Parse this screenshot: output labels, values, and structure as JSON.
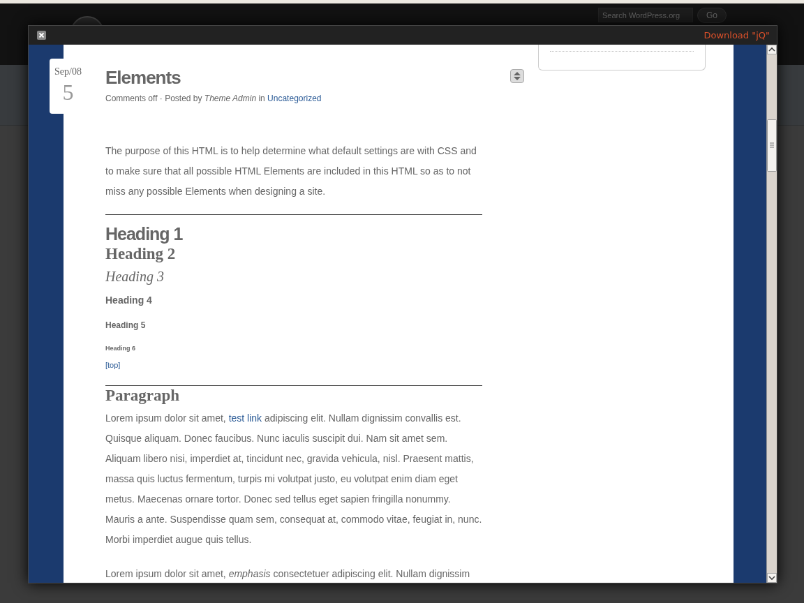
{
  "background_page": {
    "search": {
      "placeholder": "Search WordPress.org"
    },
    "go_button": "Go"
  },
  "modal": {
    "download_link": "Download \"jQ\""
  },
  "post": {
    "date": {
      "month": "Sep/08",
      "day": "5"
    },
    "title": "Elements",
    "meta": "Comments off · Posted by *Theme Admin* in",
    "category": "Uncategorized",
    "intro": "The purpose of this HTML is to help determine what default settings are with CSS and to make sure that all possible HTML Elements are included in this HTML so as to not miss any possible Elements when designing a site.",
    "headings": [
      {
        "kind": "h1",
        "text": "Heading 1"
      },
      {
        "kind": "h2",
        "text": "Heading 2"
      },
      {
        "kind": "h3",
        "text": "Heading 3"
      },
      {
        "kind": "h4",
        "text": "Heading 4"
      },
      {
        "kind": "h5",
        "text": "Heading 5"
      },
      {
        "kind": "h6",
        "text": "Heading 6"
      }
    ],
    "top_link": "[top]",
    "section_title": "Paragraph",
    "paragraphs": [
      [
        {
          "kind": "text",
          "text": "Lorem ipsum dolor sit amet,"
        },
        {
          "kind": "link",
          "text": "test link"
        },
        {
          "kind": "text",
          "text": "adipiscing elit. Nullam dignissim convallis est. Quisque aliquam. Donec faucibus. Nunc iaculis suscipit dui. Nam sit amet sem. Aliquam libero nisi, imperdiet at, tincidunt nec, gravida vehicula, nisl. Praesent mattis, massa quis luctus fermentum, turpis mi volutpat justo, eu volutpat enim diam eget metus. Maecenas ornare tortor. Donec sed tellus eget sapien fringilla nonummy. Mauris a ante. Suspendisse quam sem, consequat at, commodo vitae, feugiat in, nunc. Morbi imperdiet augue quis tellus."
        }
      ],
      [
        {
          "kind": "text",
          "text": "Lorem ipsum dolor sit amet, *emphasis* consectetuer adipiscing elit. Nullam dignissim"
        }
      ]
    ]
  }
}
